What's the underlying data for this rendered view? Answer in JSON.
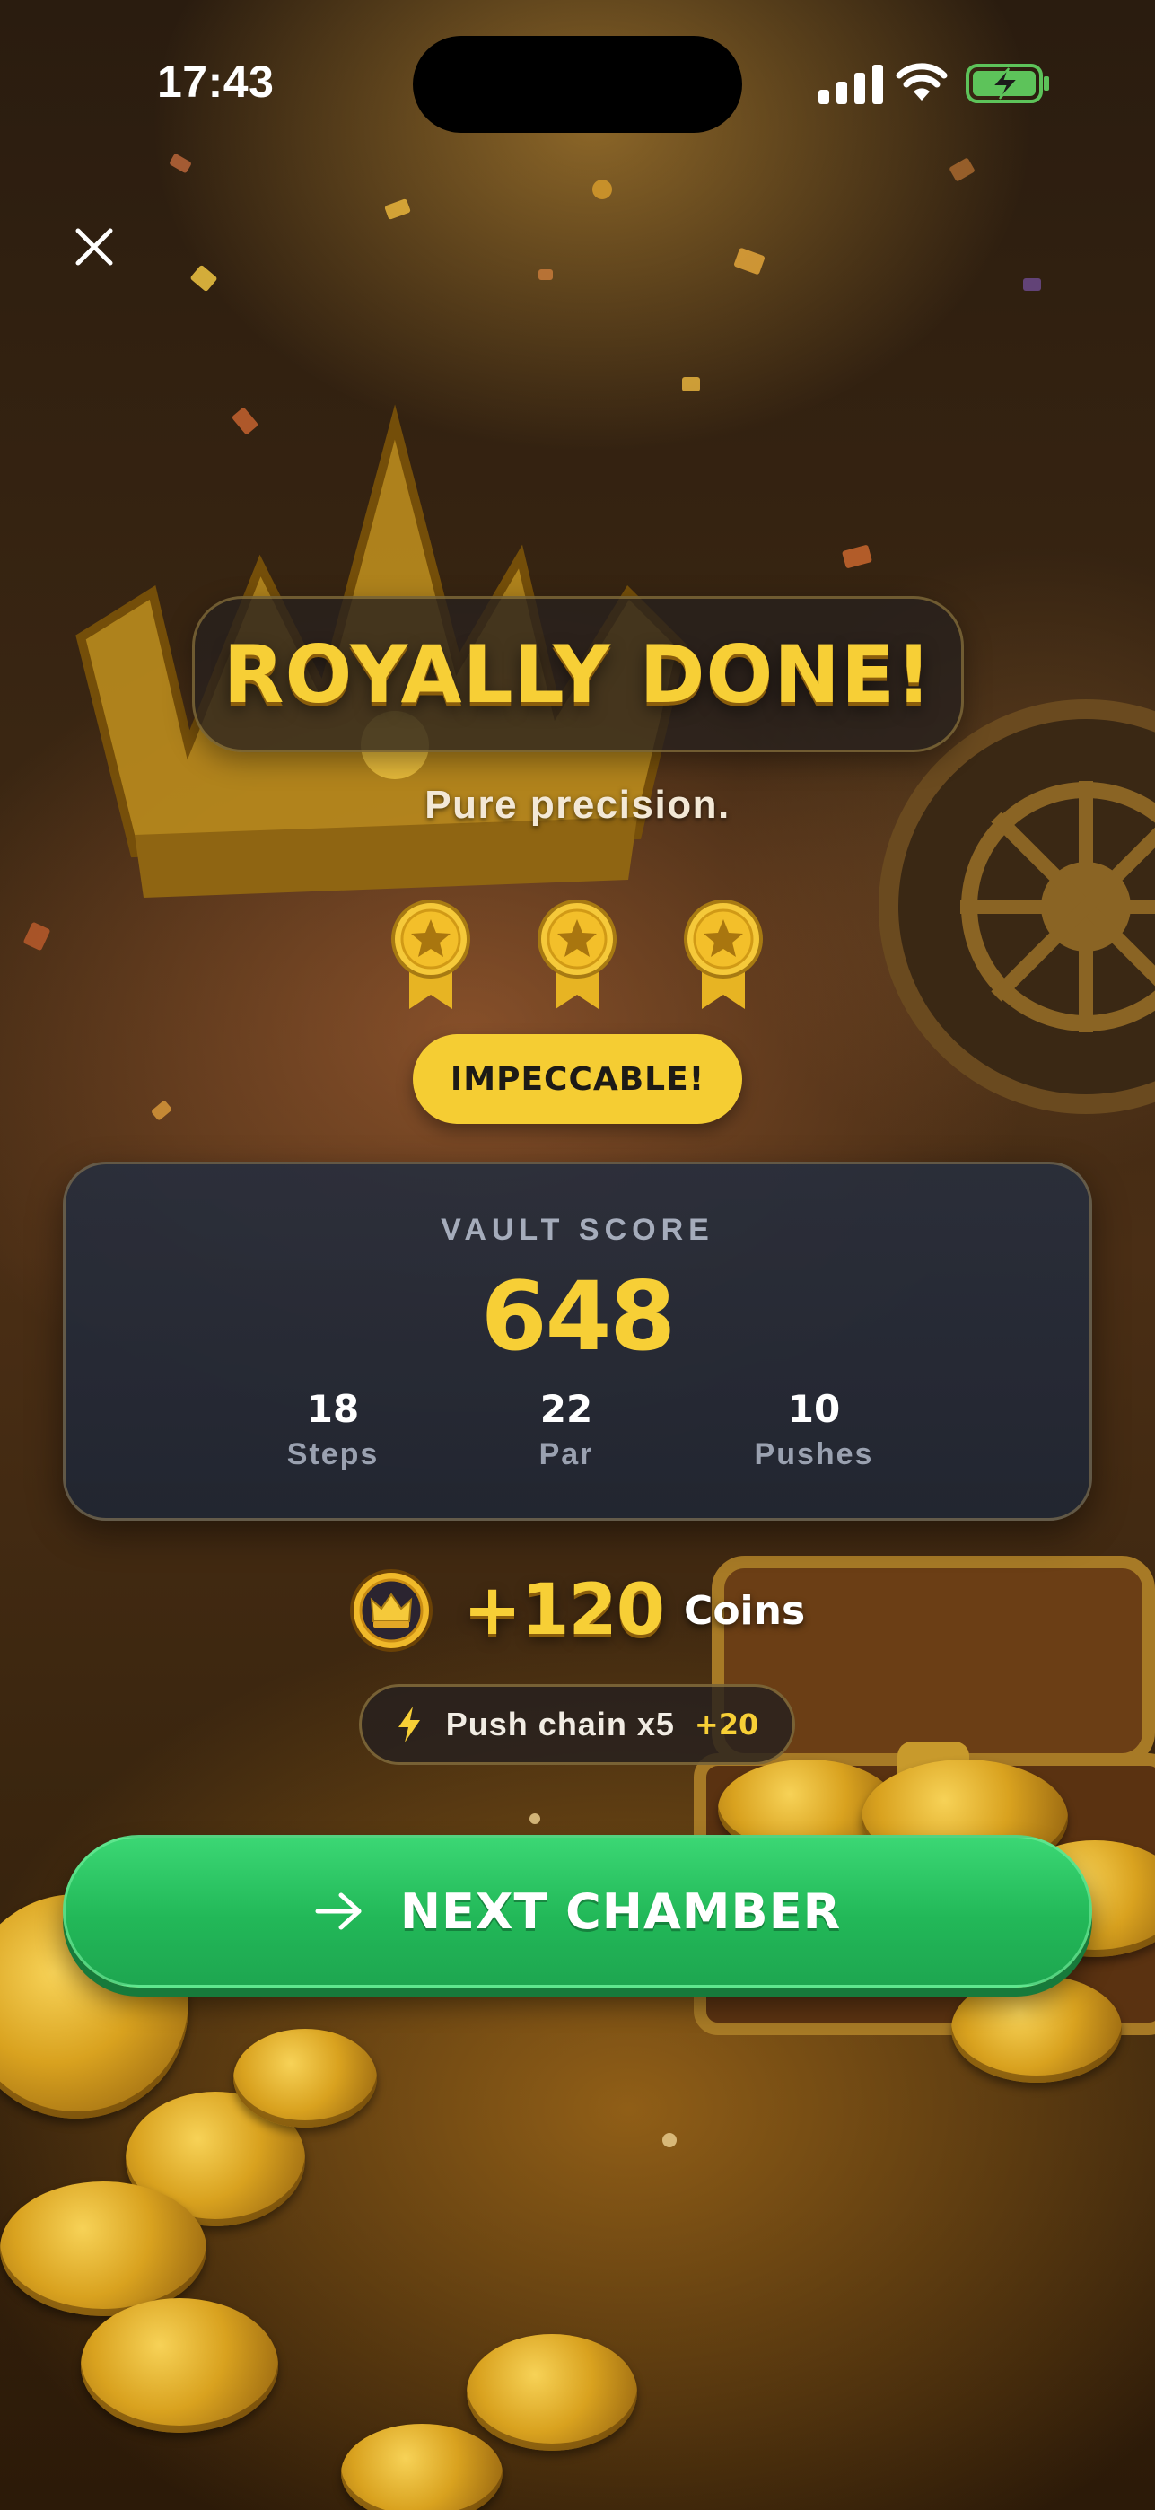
{
  "status_bar": {
    "time": "17:43",
    "icons": [
      "cellular-signal-icon",
      "wifi-icon",
      "battery-charging-icon"
    ]
  },
  "close_icon": "close-icon",
  "result": {
    "title": "ROYALLY DONE!",
    "subtitle": "Pure precision.",
    "medals_earned": 3,
    "medals_total": 3,
    "rank": "IMPECCABLE!"
  },
  "score_card": {
    "label": "VAULT SCORE",
    "value": "648",
    "stats": [
      {
        "value": "18",
        "label": "Steps"
      },
      {
        "value": "22",
        "label": "Par"
      },
      {
        "value": "10",
        "label": "Pushes"
      }
    ]
  },
  "reward": {
    "icon": "crown-coin-icon",
    "amount": "+120",
    "label": "Coins"
  },
  "bonus": {
    "icon": "lightning-bolt-icon",
    "label": "Push chain x5",
    "amount": "+20"
  },
  "cta": {
    "icon": "arrow-right-icon",
    "label": "NEXT CHAMBER"
  },
  "colors": {
    "gold": "#f7cf36",
    "card": "#232a38",
    "cta_green": "#22b858",
    "text_muted": "#a5acbb"
  }
}
